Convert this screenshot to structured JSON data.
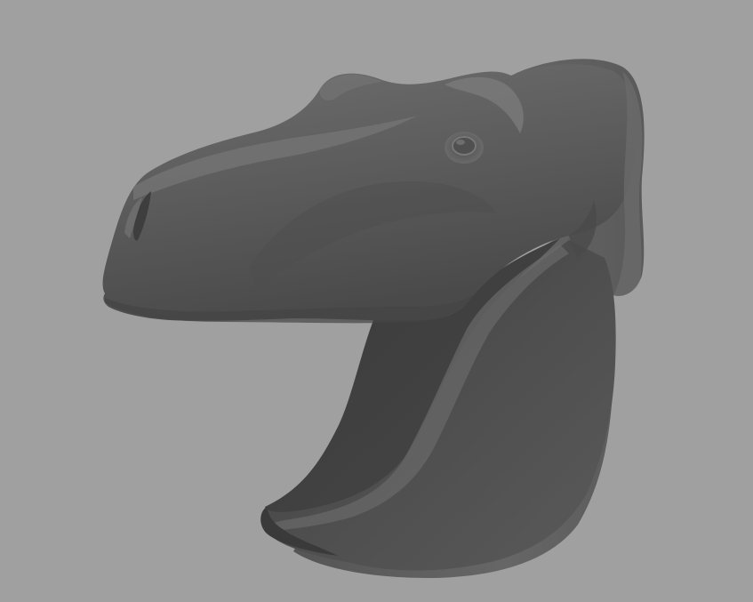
{
  "viewport": {
    "background_color": "#a0a0a0",
    "shading": "smooth-shaded",
    "model_color": "#5c5c5c",
    "subject": "dinosaur-head-model"
  }
}
